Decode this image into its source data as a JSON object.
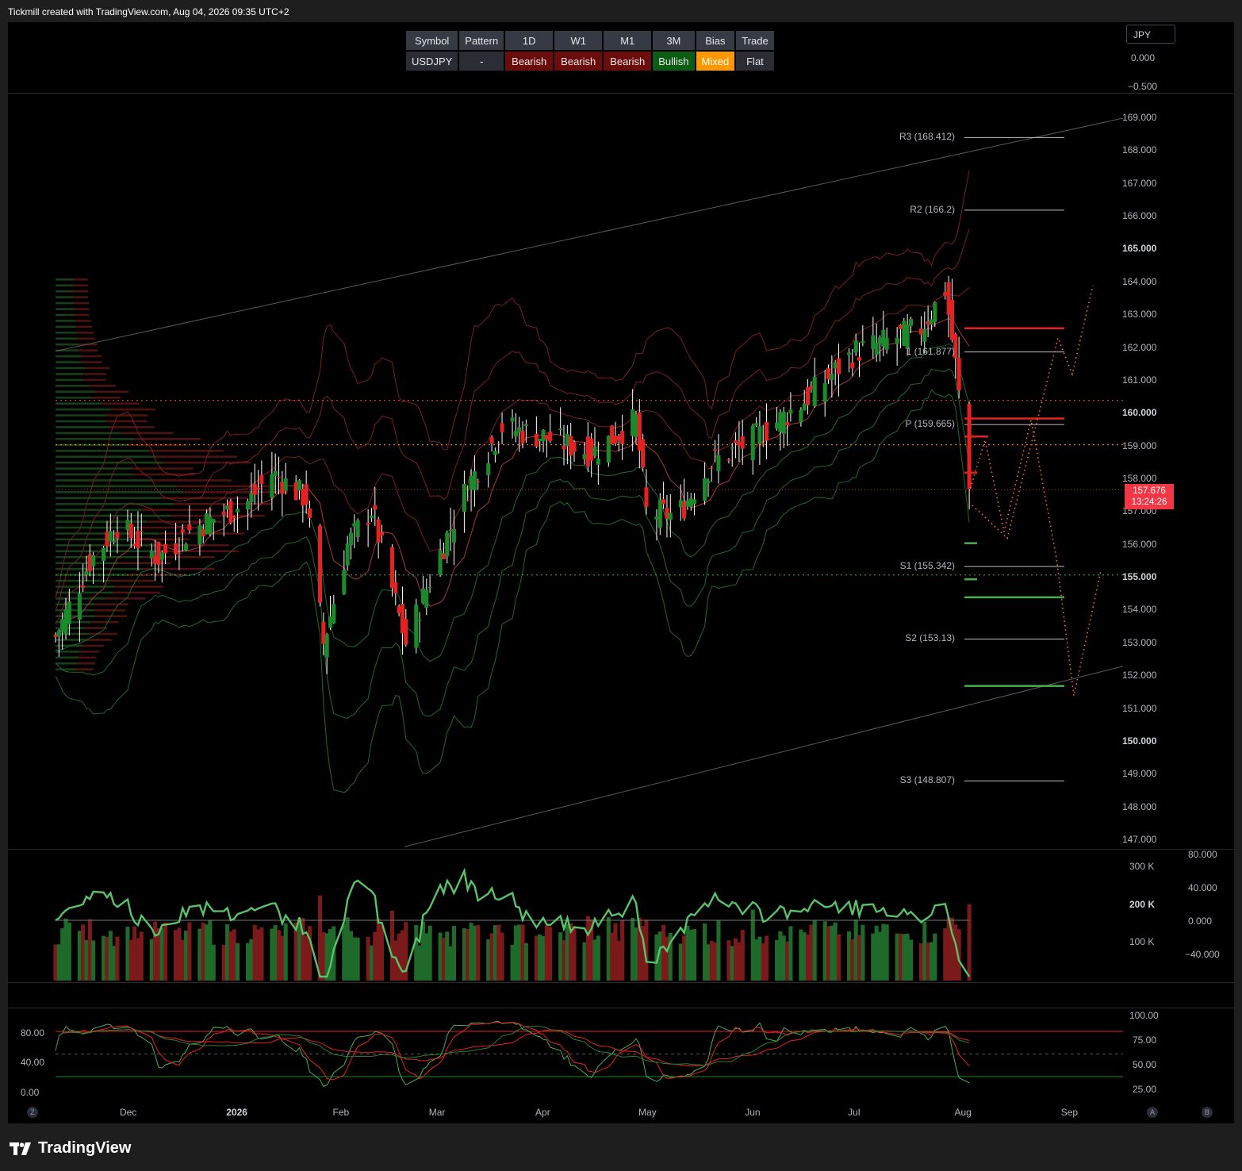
{
  "header": {
    "credit": "Tickmill created with TradingView.com, Aug 04, 2026 09:35 UTC+2"
  },
  "currency_button": "JPY",
  "bias_table": {
    "headers": [
      "Symbol",
      "Pattern",
      "1D",
      "W1",
      "M1",
      "3M",
      "Bias",
      "Trade"
    ],
    "row": [
      "USDJPY",
      "-",
      "Bearish",
      "Bearish",
      "Bearish",
      "Bullish",
      "Mixed",
      "Flat"
    ]
  },
  "top_pane_axis": [
    "0.000",
    "−0.500"
  ],
  "price_axis": [
    "169.000",
    "168.000",
    "167.000",
    "166.000",
    "165.000",
    "164.000",
    "163.000",
    "162.000",
    "161.000",
    "160.000",
    "159.000",
    "158.000",
    "157.000",
    "156.000",
    "155.000",
    "154.000",
    "153.000",
    "152.000",
    "151.000",
    "150.000",
    "149.000",
    "148.000",
    "147.000"
  ],
  "price_axis_bold": [
    "165.000",
    "160.000",
    "155.000",
    "150.000"
  ],
  "last_price": {
    "value": "157.676",
    "countdown": "13:24:26"
  },
  "pivots": {
    "r3": "R3 (168.412)",
    "r2": "R2 (166.2)",
    "r1": "1 (161.877)",
    "p": "P (159.665)",
    "s1": "S1 (155.342)",
    "s2": "S2 (153.13)",
    "s3": "S3 (148.807)"
  },
  "volume_axis": [
    "300 K",
    "200 K",
    "100 K"
  ],
  "momentum_axis": [
    "80.000",
    "40.000",
    "0.000",
    "−40.000"
  ],
  "stoch_axis_left": [
    "80.00",
    "40.00",
    "0.00"
  ],
  "stoch_axis_right": [
    "100.00",
    "75.00",
    "50.00",
    "25.00"
  ],
  "time_axis": [
    "Dec",
    "2026",
    "Feb",
    "Mar",
    "Apr",
    "May",
    "Jun",
    "Jul",
    "Aug",
    "Sep"
  ],
  "time_axis_bold": [
    "2026"
  ],
  "footer": {
    "brand": "TradingView",
    "btn_z": "Z",
    "btn_a": "A",
    "btn_b": "B"
  },
  "colors": {
    "bull": "#1b8a2a",
    "bear": "#e32222",
    "background": "#000000",
    "bias_bearish": "#6b0d0d",
    "bias_bullish": "#0d5c14",
    "bias_mixed": "#ff9800",
    "last_price": "#f23645"
  },
  "chart_data": {
    "type": "candlestick",
    "symbol": "USDJPY",
    "y_range": [
      147,
      169
    ],
    "x_range": [
      "2025-11-10",
      "2026-09-20"
    ],
    "approx_daily_closes": [
      [
        "2025-11-10",
        153.2
      ],
      [
        "2025-11-20",
        155.5
      ],
      [
        "2025-11-28",
        156.6
      ],
      [
        "2025-12-10",
        155.6
      ],
      [
        "2025-12-20",
        156.5
      ],
      [
        "2026-01-05",
        157.3
      ],
      [
        "2026-01-12",
        158.2
      ],
      [
        "2026-01-22",
        157.4
      ],
      [
        "2026-01-27",
        153.0
      ],
      [
        "2026-02-03",
        156.0
      ],
      [
        "2026-02-10",
        157.1
      ],
      [
        "2026-02-20",
        153.0
      ],
      [
        "2026-03-01",
        155.5
      ],
      [
        "2026-03-10",
        157.8
      ],
      [
        "2026-03-20",
        159.6
      ],
      [
        "2026-04-01",
        159.3
      ],
      [
        "2026-04-15",
        158.8
      ],
      [
        "2026-04-28",
        159.8
      ],
      [
        "2026-05-01",
        157.0
      ],
      [
        "2026-05-10",
        156.9
      ],
      [
        "2026-05-20",
        158.5
      ],
      [
        "2026-06-01",
        159.2
      ],
      [
        "2026-06-15",
        160.3
      ],
      [
        "2026-07-01",
        161.9
      ],
      [
        "2026-07-10",
        162.2
      ],
      [
        "2026-07-20",
        162.6
      ],
      [
        "2026-07-27",
        163.8
      ],
      [
        "2026-07-30",
        161.5
      ],
      [
        "2026-08-03",
        157.676
      ]
    ],
    "pivot_levels": {
      "R3": 168.412,
      "R2": 166.2,
      "R1": 161.877,
      "P": 159.665,
      "S1": 155.342,
      "S2": 153.13,
      "S3": 148.807
    },
    "last": 157.676
  }
}
